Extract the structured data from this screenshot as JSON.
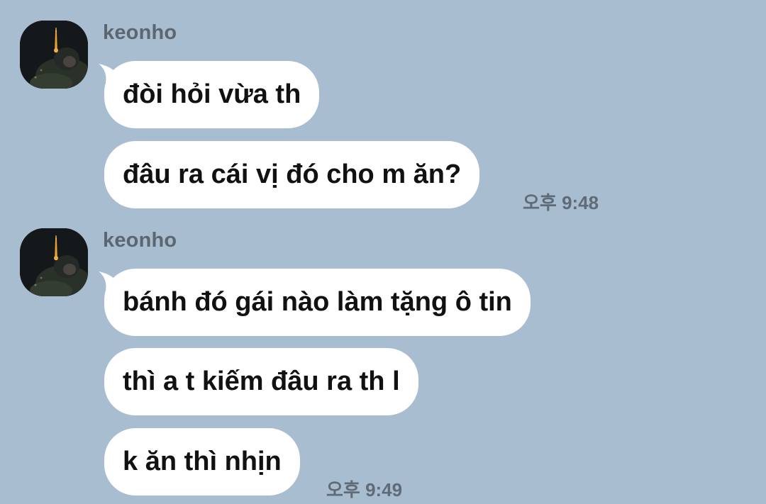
{
  "chat": {
    "groups": [
      {
        "sender": "keonho",
        "messages": [
          "đòi hỏi vừa th",
          "đâu ra cái vị đó cho m ăn?"
        ],
        "time": "오후 9:48"
      },
      {
        "sender": "keonho",
        "messages": [
          "bánh đó gái nào làm tặng ô tin",
          "thì a t kiếm đâu ra th l",
          "k ăn thì nhịn"
        ],
        "time": "오후 9:49"
      }
    ]
  },
  "colors": {
    "background": "#a9bdd1",
    "bubble": "#ffffff",
    "sender_text": "#5c6670",
    "message_text": "#111111",
    "time_text": "#5f6b77"
  },
  "icons": {
    "avatar": "profile-photo-avatar"
  }
}
